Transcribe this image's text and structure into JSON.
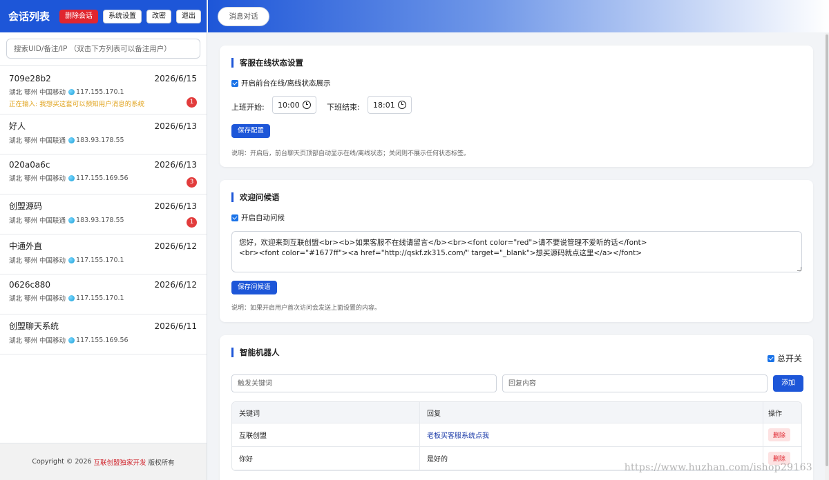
{
  "sidebar": {
    "title": "会话列表",
    "buttons": {
      "delete_session": "删除会话",
      "system_settings": "系统设置",
      "change_password": "改密",
      "logout": "退出"
    },
    "search_placeholder": "搜索UID/备注/IP （双击下方列表可以备注用户）",
    "sessions": [
      {
        "name": "709e28b2",
        "date": "2026/6/15",
        "location": "湖北 鄂州 中国移动",
        "ip": "117.155.170.1",
        "typing": "正在输入: 我想买这套可以预知用户消息的系统",
        "unread": "1"
      },
      {
        "name": "好人",
        "date": "2026/6/13",
        "location": "湖北 鄂州 中国联通",
        "ip": "183.93.178.55",
        "unread": ""
      },
      {
        "name": "020a0a6c",
        "date": "2026/6/13",
        "location": "湖北 鄂州 中国移动",
        "ip": "117.155.169.56",
        "unread": "3"
      },
      {
        "name": "创盟源码",
        "date": "2026/6/13",
        "location": "湖北 鄂州 中国联通",
        "ip": "183.93.178.55",
        "unread": "1"
      },
      {
        "name": "中通外直",
        "date": "2026/6/12",
        "location": "湖北 鄂州 中国移动",
        "ip": "117.155.170.1",
        "unread": ""
      },
      {
        "name": "0626c880",
        "date": "2026/6/12",
        "location": "湖北 鄂州 中国移动",
        "ip": "117.155.170.1",
        "unread": ""
      },
      {
        "name": "创盟聊天系统",
        "date": "2026/6/11",
        "location": "湖北 鄂州 中国移动",
        "ip": "117.155.169.56",
        "unread": ""
      }
    ],
    "footer": {
      "prefix": "Copyright © 2026",
      "brand": "互联创盟独家开发",
      "suffix": "版权所有"
    }
  },
  "topbar": {
    "tab_label": "消息对话"
  },
  "online_status": {
    "title": "客服在线状态设置",
    "checkbox_label": "开启前台在线/离线状态展示",
    "start_label": "上班开始:",
    "start_value": "10:00",
    "end_label": "下班结束:",
    "end_value": "18:01",
    "save_label": "保存配置",
    "note": "说明：开启后，前台聊天页顶部自动显示在线/离线状态；关闭则不展示任何状态标签。"
  },
  "greeting": {
    "title": "欢迎问候语",
    "checkbox_label": "开启自动问候",
    "content": "您好，欢迎来到互联创盟<br><b>如果客服不在线请留言</b><br><font color=\"red\">请不要说管理不爱听的话</font>\n<br><font color=\"#1677ff\"><a href=\"http://qskf.zk315.com/\" target=\"_blank\">想买源码就点这里</a></font>",
    "save_label": "保存问候语",
    "note": "说明：如果开启用户首次访问会发送上面设置的内容。"
  },
  "robot": {
    "title": "智能机器人",
    "master_switch_label": "总开关",
    "keyword_placeholder": "触发关键词",
    "reply_placeholder": "回复内容",
    "add_label": "添加",
    "columns": {
      "keyword": "关键词",
      "reply": "回复",
      "action": "操作"
    },
    "rows": [
      {
        "keyword": "互联创盟",
        "reply": "老板买客服系统点我",
        "action": "删除"
      },
      {
        "keyword": "你好",
        "reply": "是好的",
        "action": "删除"
      }
    ]
  },
  "watermark": "https://www.huzhan.com/ishop29163"
}
